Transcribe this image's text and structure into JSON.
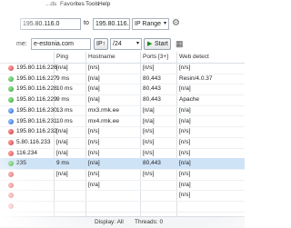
{
  "menubar": {
    "items": [
      "...ds",
      "Favorites",
      "Tools",
      "Help"
    ]
  },
  "toolbar": {
    "range_from": "195.80.116.0",
    "to_label": "to",
    "range_to": "195.80.116.255",
    "mode": "IP Range",
    "hostname_label": "me:",
    "hostname_value": "e-estonia.com",
    "ip_button": "IP↑",
    "netmask": "/24",
    "start": "Start"
  },
  "table": {
    "columns": [
      "Ping",
      "Hostname",
      "Ports [3+]",
      "Web detect"
    ],
    "rows": [
      {
        "ip": "195.80.116.226",
        "ping": "[n/a]",
        "host": "[n/s]",
        "ports": "[n/s]",
        "web": "[n/s]",
        "status": "red"
      },
      {
        "ip": "195.80.116.227",
        "ping": "9 ms",
        "host": "[n/a]",
        "ports": "80,443",
        "web": "Resin/4.0.37",
        "status": "green"
      },
      {
        "ip": "195.80.116.228",
        "ping": "10 ms",
        "host": "[n/a]",
        "ports": "80,443",
        "web": "[n/a]",
        "status": "green"
      },
      {
        "ip": "195.80.116.229",
        "ping": "9 ms",
        "host": "[n/a]",
        "ports": "80,443",
        "web": "Apache",
        "status": "green"
      },
      {
        "ip": "195.80.116.230",
        "ping": "13 ms",
        "host": "mx3.rmk.ee",
        "ports": "[n/a]",
        "web": "[n/a]",
        "status": "blue"
      },
      {
        "ip": "195.80.116.231",
        "ping": "10 ms",
        "host": "mx4.rmk.ee",
        "ports": "[n/a]",
        "web": "[n/a]",
        "status": "blue"
      },
      {
        "ip": "195.80.116.232",
        "ping": "[n/a]",
        "host": "[n/s]",
        "ports": "[n/s]",
        "web": "[n/s]",
        "status": "red"
      },
      {
        "ip": "5.80.116.233",
        "ping": "[n/a]",
        "host": "[n/s]",
        "ports": "[n/s]",
        "web": "[n/s]",
        "status": "red"
      },
      {
        "ip": "116.234",
        "ping": "[n/a]",
        "host": "[n/s]",
        "ports": "[n/s]",
        "web": "[n/s]",
        "status": "red"
      },
      {
        "ip": "235",
        "ping": "9 ms",
        "host": "[n/a]",
        "ports": "80,443",
        "web": "[n/a]",
        "status": "green",
        "selected": true
      },
      {
        "ip": "",
        "ping": "[n/a]",
        "host": "[n/s]",
        "ports": "[n/s]",
        "web": "[n/s]",
        "status": "red"
      },
      {
        "ip": "",
        "ping": "",
        "host": "[n/a]",
        "ports": "",
        "web": "[n/a]",
        "status": "red"
      },
      {
        "ip": "",
        "ping": "",
        "host": "",
        "ports": "",
        "web": "[n/s]",
        "status": "red"
      },
      {
        "ip": "",
        "ping": "",
        "host": "",
        "ports": "",
        "web": "",
        "status": "red"
      }
    ]
  },
  "statusbar": {
    "display": "Display: All",
    "threads": "Threads: 0"
  }
}
